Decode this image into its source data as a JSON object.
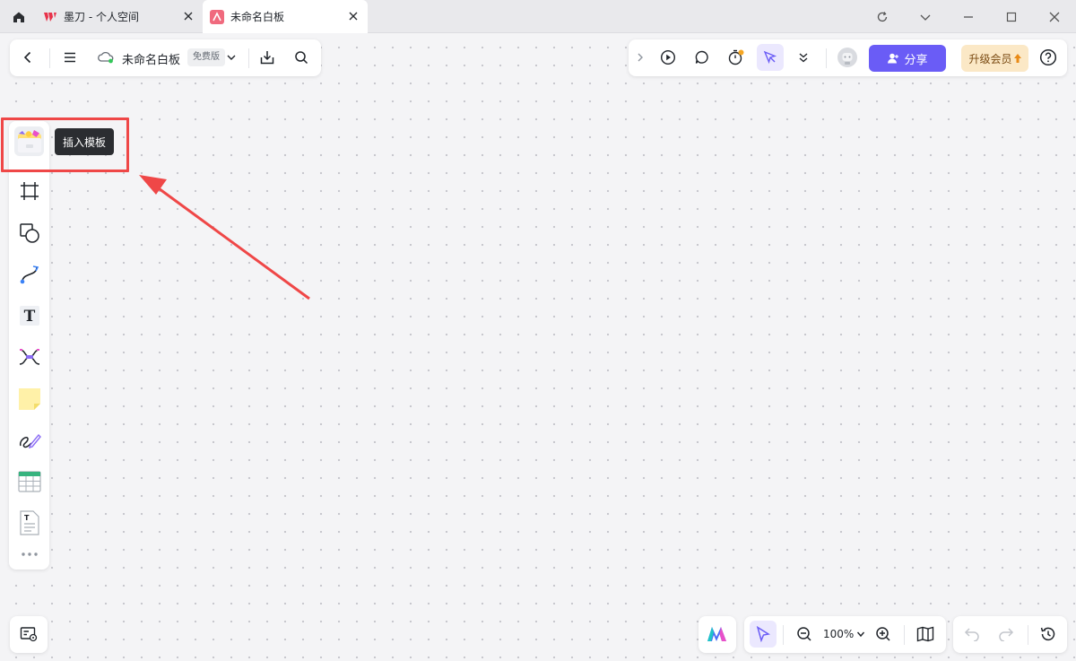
{
  "tabs": [
    {
      "label": "墨刀 - 个人空间",
      "active": false
    },
    {
      "label": "未命名白板",
      "active": true
    }
  ],
  "header": {
    "title": "未命名白板",
    "plan_badge": "免费版"
  },
  "actions": {
    "share_label": "分享",
    "upgrade_label": "升级会员"
  },
  "tooltip": {
    "insert_template": "插入模板"
  },
  "zoom": {
    "level": "100%"
  },
  "colors": {
    "accent": "#6a5cf6",
    "upgrade_bg": "#fbe8c6",
    "annotation": "#ef4747",
    "canvas_bg": "#f4f4f6"
  }
}
